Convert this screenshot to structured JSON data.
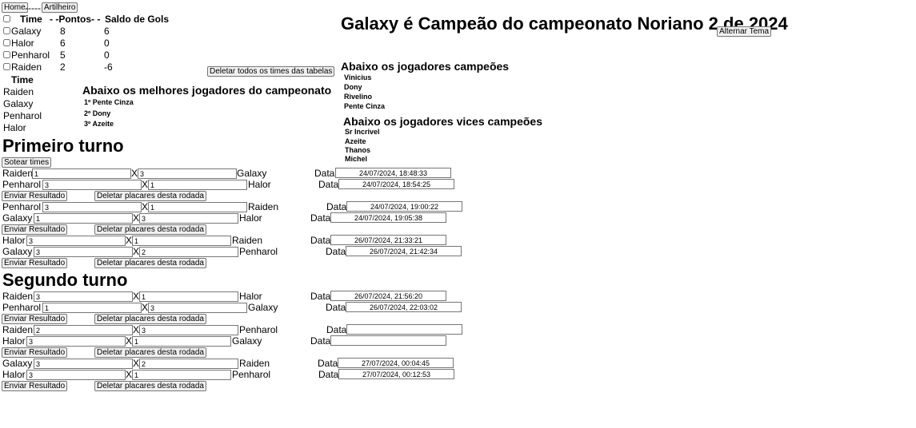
{
  "nav": {
    "home": "Home",
    "separator": "-----",
    "artilheiro": "Artilheiro"
  },
  "standings": {
    "headers": {
      "time": "Time",
      "pontos": "- -Pontos- -",
      "saldo": "Saldo de Gols"
    },
    "rows": [
      {
        "team": "Galaxy",
        "points": "8",
        "goal_diff": "6"
      },
      {
        "team": "Halor",
        "points": "6",
        "goal_diff": "0"
      },
      {
        "team": "Penharol",
        "points": "5",
        "goal_diff": "0"
      },
      {
        "team": "Raiden",
        "points": "2",
        "goal_diff": "-6"
      }
    ]
  },
  "delete_all_label": "Deletar todos os times das tabelas",
  "team_list": {
    "header": "Time",
    "items": [
      "Raiden",
      "Galaxy",
      "Penharol",
      "Halor"
    ]
  },
  "best_players": {
    "title": "Abaixo os melhores jogadores do campeonato",
    "items": [
      "1º Pente Cinza",
      "2º Dony",
      "3º Azeite"
    ]
  },
  "champion_title": "Galaxy é Campeão do campeonato Noriano 2 de 2024",
  "toggle_theme_label": "Alternar Tema",
  "champions": {
    "title": "Abaixo os jogadores campeões",
    "players": [
      "Vinicius",
      "Dony",
      "Rivelino",
      "Pente Cinza"
    ]
  },
  "vice_champions": {
    "title": "Abaixo os jogadores vices campeões",
    "players": [
      "Sr Incrivel",
      "Azeite",
      "Thanos",
      "Michel"
    ]
  },
  "first_round": {
    "title": "Primeiro turno",
    "draw_label": "Sotear times",
    "matches": [
      {
        "home": "Raiden",
        "home_score": "1",
        "x": "X",
        "away_score": "3",
        "away": "Galaxy",
        "data_label": "Data",
        "date": "24/07/2024, 18:48:33"
      },
      {
        "home": "Penharol",
        "home_score": "3",
        "x": "X",
        "away_score": "1",
        "away": "Halor",
        "data_label": "Data",
        "date": "24/07/2024, 18:54:25"
      },
      {
        "home": "Penharol",
        "home_score": "3",
        "x": "X",
        "away_score": "1",
        "away": "Raiden",
        "data_label": "Data",
        "date": "24/07/2024, 19:00:22"
      },
      {
        "home": "Galaxy",
        "home_score": "1",
        "x": "X",
        "away_score": "3",
        "away": "Halor",
        "data_label": "Data",
        "date": "24/07/2024, 19:05:38"
      },
      {
        "home": "Halor",
        "home_score": "3",
        "x": "X",
        "away_score": "1",
        "away": "Raiden",
        "data_label": "Data",
        "date": "26/07/2024, 21:33:21"
      },
      {
        "home": "Galaxy",
        "home_score": "3",
        "x": "X",
        "away_score": "2",
        "away": "Penharol",
        "data_label": "Data",
        "date": "26/07/2024, 21:42:34"
      }
    ]
  },
  "second_round": {
    "title": "Segundo turno",
    "matches": [
      {
        "home": "Raiden",
        "home_score": "3",
        "x": "X",
        "away_score": "1",
        "away": "Halor",
        "data_label": "Data",
        "date": "26/07/2024, 21:56:20"
      },
      {
        "home": "Penharol",
        "home_score": "1",
        "x": "X",
        "away_score": "3",
        "away": "Galaxy",
        "data_label": "Data",
        "date": "26/07/2024, 22:03:02"
      },
      {
        "home": "Raiden",
        "home_score": "2",
        "x": "X",
        "away_score": "3",
        "away": "Penharol",
        "data_label": "Data",
        "date": ""
      },
      {
        "home": "Halor",
        "home_score": "3",
        "x": "X",
        "away_score": "1",
        "away": "Galaxy",
        "data_label": "Data",
        "date": ""
      },
      {
        "home": "Galaxy",
        "home_score": "3",
        "x": "X",
        "away_score": "2",
        "away": "Raiden",
        "data_label": "Data",
        "date": "27/07/2024, 00:04:45"
      },
      {
        "home": "Halor",
        "home_score": "3",
        "x": "X",
        "away_score": "1",
        "away": "Penharol",
        "data_label": "Data",
        "date": "27/07/2024, 00:12:53"
      }
    ]
  },
  "round_buttons": {
    "send": "Enviar Resultado",
    "delete": "Deletar placares desta rodada"
  }
}
